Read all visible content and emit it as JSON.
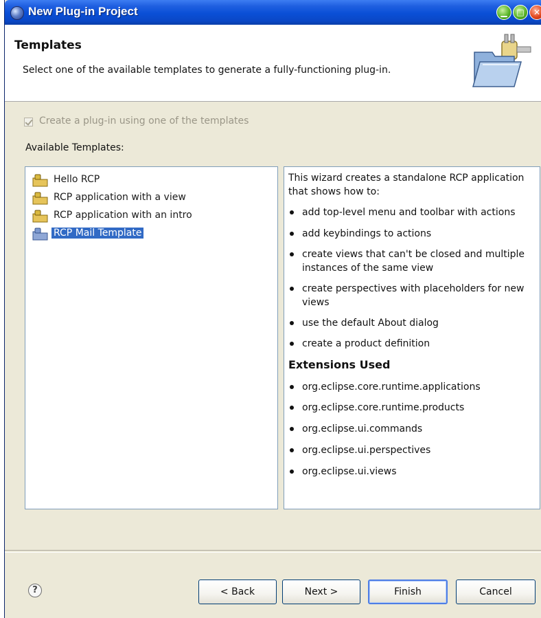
{
  "window": {
    "title": "New Plug-in Project"
  },
  "banner": {
    "title": "Templates",
    "description": "Select one of the available templates to generate a fully-functioning plug-in.",
    "graphic_icon": "folder-plugin-icon"
  },
  "options": {
    "use_template_label": "Create a plug-in using one of the templates",
    "use_template_checked": true,
    "use_template_enabled": false
  },
  "templates": {
    "label": "Available Templates:",
    "items": [
      {
        "label": "Hello RCP",
        "selected": false
      },
      {
        "label": "RCP application with a view",
        "selected": false
      },
      {
        "label": "RCP application with an intro",
        "selected": false
      },
      {
        "label": "RCP Mail Template",
        "selected": true
      }
    ]
  },
  "description": {
    "intro": "This wizard creates a standalone RCP application that shows how to:",
    "features": [
      "add top-level menu and toolbar with actions",
      "add keybindings to actions",
      "create views that can't be closed and multiple instances of the same view",
      "create perspectives with placeholders for new views",
      "use the default About dialog",
      "create a product definition"
    ],
    "extensions_heading": "Extensions Used",
    "extensions": [
      "org.eclipse.core.runtime.applications",
      "org.eclipse.core.runtime.products",
      "org.eclipse.ui.commands",
      "org.eclipse.ui.perspectives",
      "org.eclipse.ui.views"
    ]
  },
  "buttons": {
    "help_icon": "help-icon",
    "back": "< Back",
    "next": "Next >",
    "finish": "Finish",
    "cancel": "Cancel",
    "default": "finish"
  },
  "colors": {
    "titlebar": "#0a4fd6",
    "selection": "#316ac5",
    "dialog_bg": "#ece9d8"
  }
}
